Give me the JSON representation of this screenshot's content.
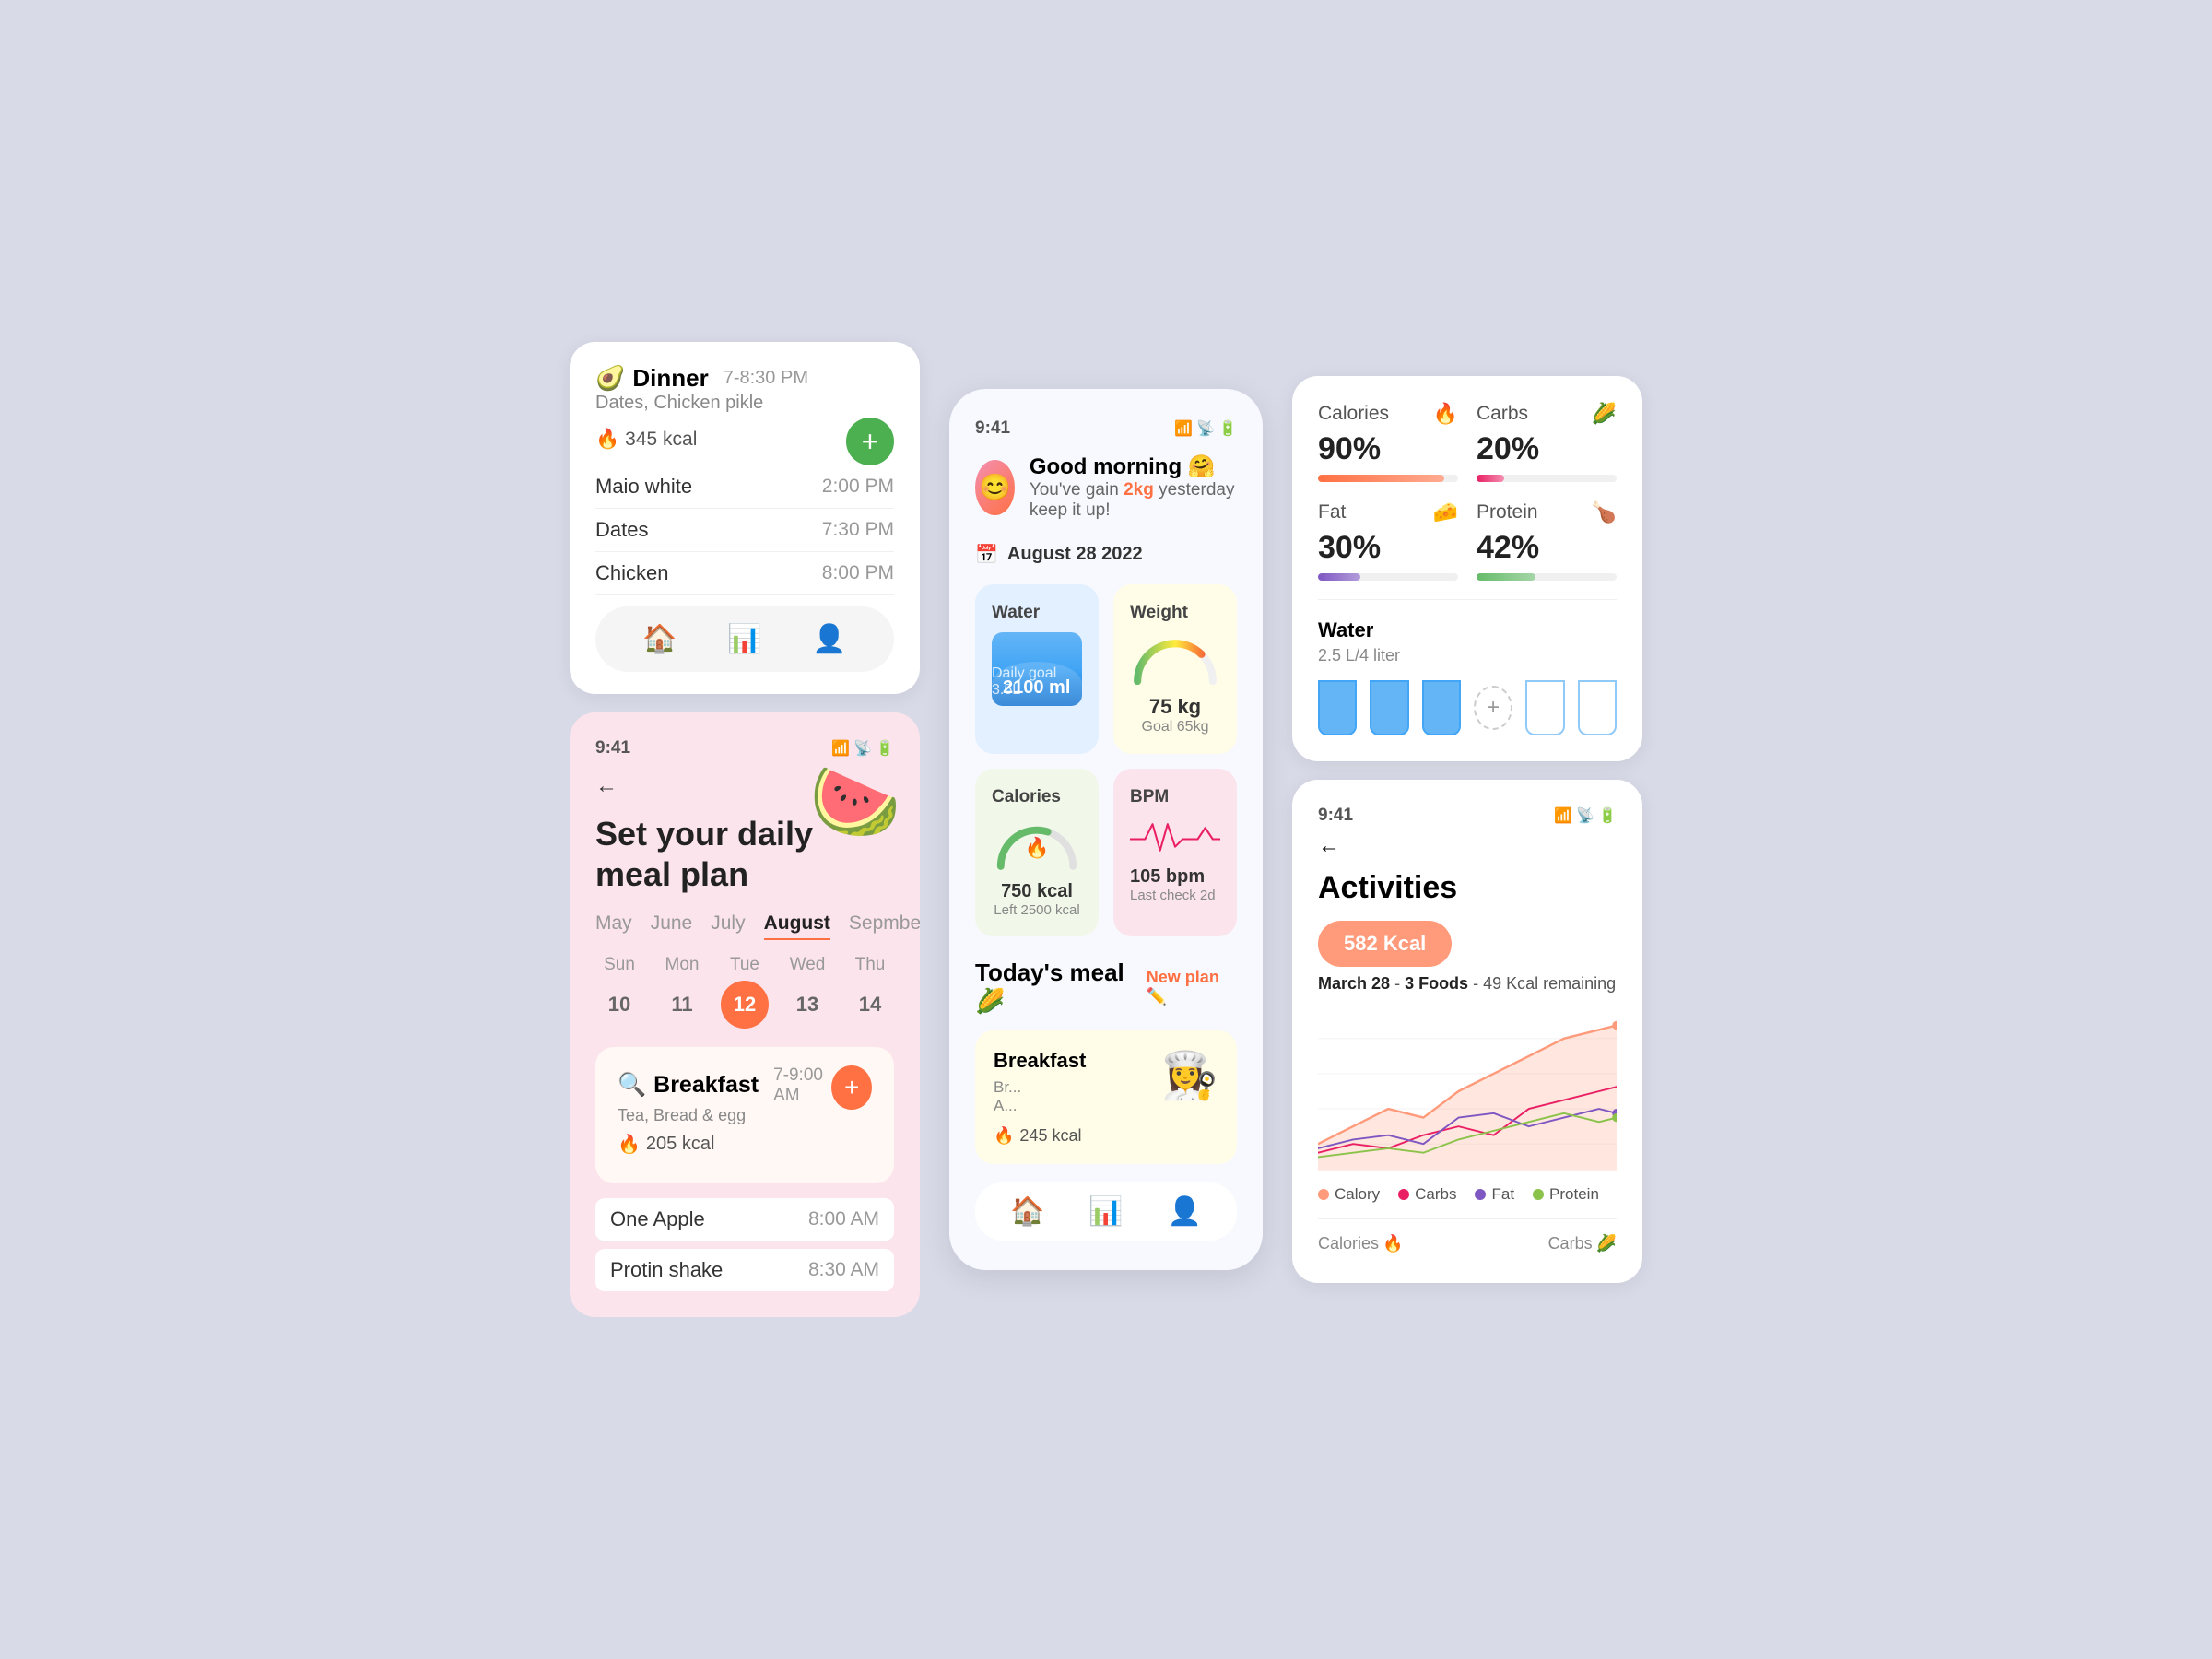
{
  "col1": {
    "top_card": {
      "items": [
        {
          "name": "Maio white",
          "time": "2:00 PM"
        },
        {
          "name": "Dates",
          "time": "7:30 PM"
        },
        {
          "name": "Chicken",
          "time": "8:00 PM"
        }
      ],
      "dinner": {
        "title": "Dinner",
        "emoji": "🥑",
        "time": "7-8:30 PM",
        "subtitle": "Dates, Chicken pikle",
        "kcal": "345 kcal"
      }
    },
    "meal_plan": {
      "status_time": "9:41",
      "title": "Set your daily\nmeal plan",
      "months": [
        "May",
        "June",
        "July",
        "August",
        "Sepmber"
      ],
      "active_month": "August",
      "days": [
        {
          "name": "Sun",
          "num": "10"
        },
        {
          "name": "Mon",
          "num": "11"
        },
        {
          "name": "Tue",
          "num": "12",
          "selected": true
        },
        {
          "name": "Wed",
          "num": "13"
        },
        {
          "name": "Thu",
          "num": "14"
        }
      ],
      "breakfast": {
        "title": "Breakfast",
        "time": "7-9:00 AM",
        "subtitle": "Tea, Bread & egg",
        "kcal": "205 kcal"
      },
      "meal_items": [
        {
          "name": "One Apple",
          "time": "8:00 AM"
        },
        {
          "name": "Protin shake",
          "time": "8:30 AM"
        }
      ]
    }
  },
  "col2": {
    "status_time": "9:41",
    "greeting": "Good morning 🤗",
    "subtitle_pre": "You've gain ",
    "subtitle_gain": "2kg",
    "subtitle_post": " yesterday keep it up!",
    "date": "August  28  2022",
    "water": {
      "title": "Water",
      "value": "2100 ml",
      "goal": "Daily goal 3.5L"
    },
    "weight": {
      "title": "Weight",
      "value": "75 kg",
      "goal": "Goal 65kg"
    },
    "calories": {
      "title": "Calories",
      "value": "750 kcal",
      "sub": "Left 2500 kcal"
    },
    "bpm": {
      "title": "BPM",
      "value": "105 bpm",
      "sub": "Last check 2d"
    },
    "todays_meal_title": "Today's meal 🌽",
    "new_plan": "New plan ✏️",
    "breakfast_card": {
      "title": "Breakfast",
      "sub1": "Br...",
      "sub2": "A...",
      "kcal": "245 kcal"
    }
  },
  "col3": {
    "nutrition": {
      "calories": {
        "label": "Calories",
        "value": "90%",
        "pct": 90
      },
      "carbs": {
        "label": "Carbs",
        "value": "20%",
        "pct": 20
      },
      "fat": {
        "label": "Fat",
        "value": "30%",
        "pct": 30
      },
      "protein": {
        "label": "Protein",
        "value": "42%",
        "pct": 42
      }
    },
    "water": {
      "title": "Water",
      "subtitle": "2.5 L/4 liter",
      "cups_filled": 3,
      "cups_total": 6
    },
    "activities": {
      "status_time": "9:41",
      "title": "Activities",
      "kcal_bubble": "582 Kcal",
      "meta_date": "March 28",
      "meta_foods": "3 Foods",
      "meta_remaining": "49 Kcal remaining",
      "legend": [
        {
          "label": "Calory",
          "color": "#ff9a7a"
        },
        {
          "label": "Carbs",
          "color": "#e91e63"
        },
        {
          "label": "Fat",
          "color": "#7e57c2"
        },
        {
          "label": "Protein",
          "color": "#8bc34a"
        }
      ]
    },
    "bottom": {
      "calories_label": "Calories",
      "carbs_label": "Carbs"
    }
  }
}
